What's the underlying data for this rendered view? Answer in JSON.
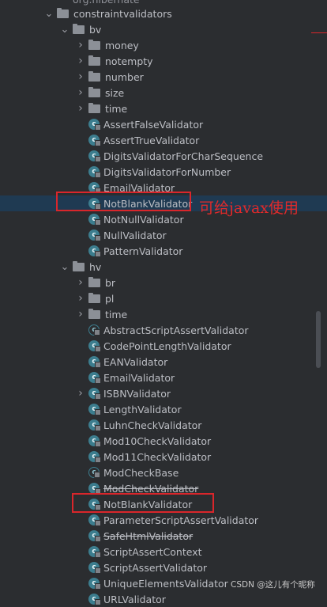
{
  "cut_top_label": "org.hibernate",
  "annotation": "可给javax使用",
  "watermark": "CSDN @这儿有个昵称",
  "colors": {
    "background": "#2b2d30",
    "selected_row": "#1f3a52",
    "highlight_box": "#d9262b",
    "annotation_text": "#e02a2a",
    "class_icon": "#3c7d8e"
  },
  "tree": [
    {
      "label": "constraintvalidators",
      "kind": "folder",
      "expanded": true,
      "depth": 0
    },
    {
      "label": "bv",
      "kind": "folder",
      "expanded": true,
      "depth": 1
    },
    {
      "label": "money",
      "kind": "folder",
      "expanded": false,
      "depth": 2
    },
    {
      "label": "notempty",
      "kind": "folder",
      "expanded": false,
      "depth": 2
    },
    {
      "label": "number",
      "kind": "folder",
      "expanded": false,
      "depth": 2
    },
    {
      "label": "size",
      "kind": "folder",
      "expanded": false,
      "depth": 2
    },
    {
      "label": "time",
      "kind": "folder",
      "expanded": false,
      "depth": 2
    },
    {
      "label": "AssertFalseValidator",
      "kind": "class",
      "depth": 2
    },
    {
      "label": "AssertTrueValidator",
      "kind": "class",
      "depth": 2
    },
    {
      "label": "DigitsValidatorForCharSequence",
      "kind": "class",
      "depth": 2
    },
    {
      "label": "DigitsValidatorForNumber",
      "kind": "class",
      "depth": 2
    },
    {
      "label": "EmailValidator",
      "kind": "class",
      "depth": 2
    },
    {
      "label": "NotBlankValidator",
      "kind": "class",
      "depth": 2,
      "selected": true
    },
    {
      "label": "NotNullValidator",
      "kind": "class",
      "depth": 2
    },
    {
      "label": "NullValidator",
      "kind": "class",
      "depth": 2
    },
    {
      "label": "PatternValidator",
      "kind": "class",
      "depth": 2
    },
    {
      "label": "hv",
      "kind": "folder",
      "expanded": true,
      "depth": 1
    },
    {
      "label": "br",
      "kind": "folder",
      "expanded": false,
      "depth": 2
    },
    {
      "label": "pl",
      "kind": "folder",
      "expanded": false,
      "depth": 2
    },
    {
      "label": "time",
      "kind": "folder",
      "expanded": false,
      "depth": 2
    },
    {
      "label": "AbstractScriptAssertValidator",
      "kind": "abstract",
      "depth": 2
    },
    {
      "label": "CodePointLengthValidator",
      "kind": "class",
      "depth": 2
    },
    {
      "label": "EANValidator",
      "kind": "class",
      "depth": 2
    },
    {
      "label": "EmailValidator",
      "kind": "class",
      "depth": 2
    },
    {
      "label": "ISBNValidator",
      "kind": "class",
      "depth": 2,
      "collapsible": true
    },
    {
      "label": "LengthValidator",
      "kind": "class",
      "depth": 2
    },
    {
      "label": "LuhnCheckValidator",
      "kind": "class",
      "depth": 2
    },
    {
      "label": "Mod10CheckValidator",
      "kind": "class",
      "depth": 2
    },
    {
      "label": "Mod11CheckValidator",
      "kind": "class",
      "depth": 2
    },
    {
      "label": "ModCheckBase",
      "kind": "abstract",
      "depth": 2
    },
    {
      "label": "ModCheckValidator",
      "kind": "class",
      "depth": 2,
      "deprecated": true
    },
    {
      "label": "NotBlankValidator",
      "kind": "class",
      "depth": 2
    },
    {
      "label": "ParameterScriptAssertValidator",
      "kind": "class",
      "depth": 2
    },
    {
      "label": "SafeHtmlValidator",
      "kind": "class",
      "depth": 2,
      "deprecated": true
    },
    {
      "label": "ScriptAssertContext",
      "kind": "class",
      "depth": 2
    },
    {
      "label": "ScriptAssertValidator",
      "kind": "class",
      "depth": 2
    },
    {
      "label": "UniqueElementsValidator",
      "kind": "class",
      "depth": 2
    },
    {
      "label": "URLValidator",
      "kind": "class",
      "depth": 2
    }
  ]
}
